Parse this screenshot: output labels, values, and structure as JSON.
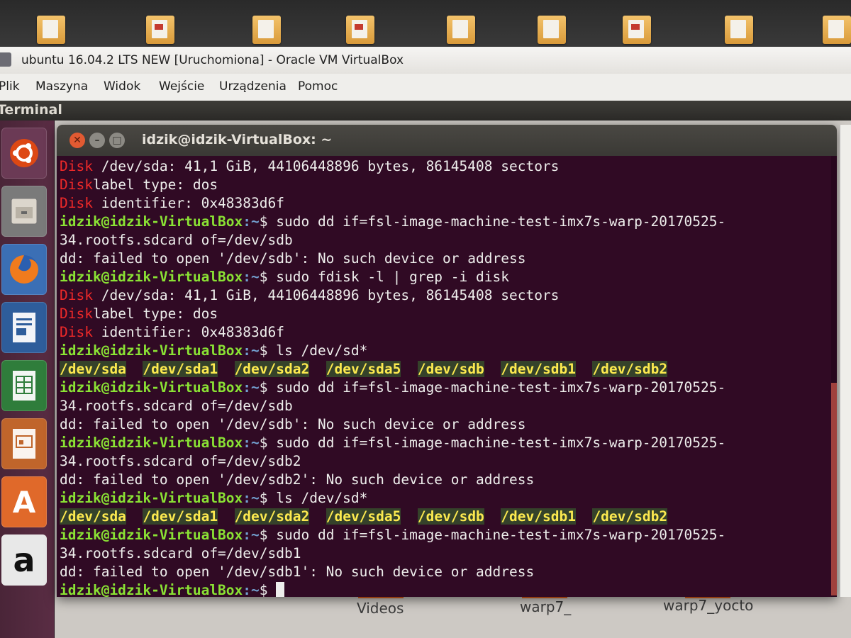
{
  "vbox": {
    "title": "ubuntu 16.04.2 LTS NEW [Uruchomiona] - Oracle VM VirtualBox",
    "menu": [
      "Plik",
      "Maszyna",
      "Widok",
      "Wejście",
      "Urządzenia",
      "Pomoc"
    ]
  },
  "guest": {
    "app_title": "Terminal",
    "launcher": [
      "ubuntu-dash-icon",
      "files-icon",
      "firefox-icon",
      "writer-icon",
      "calc-icon",
      "impress-icon",
      "software-center-icon",
      "amazon-icon"
    ],
    "desktop_labels": [
      "Videos",
      "warp7_",
      "warp7_yocto"
    ]
  },
  "terminal": {
    "title": "idzik@idzik-VirtualBox: ~",
    "prompt_user": "idzik@idzik-VirtualBox",
    "prompt_path": ":~",
    "prompt_sym": "$ ",
    "lines": [
      {
        "k": "disk",
        "red": "Disk",
        "rest": " /dev/sda: 41,1 GiB, 44106448896 bytes, 86145408 sectors"
      },
      {
        "k": "disk",
        "red": "Disk",
        "rest": "label type: dos"
      },
      {
        "k": "disk",
        "red": "Disk",
        "rest": " identifier: 0x48383d6f"
      },
      {
        "k": "cmd",
        "cmd": "sudo dd if=fsl-image-machine-test-imx7s-warp-20170525-"
      },
      {
        "k": "text",
        "text": "34.rootfs.sdcard of=/dev/sdb"
      },
      {
        "k": "text",
        "text": "dd: failed to open '/dev/sdb': No such device or address"
      },
      {
        "k": "cmd",
        "cmd": "sudo fdisk -l | grep -i disk"
      },
      {
        "k": "disk",
        "red": "Disk",
        "rest": " /dev/sda: 41,1 GiB, 44106448896 bytes, 86145408 sectors"
      },
      {
        "k": "disk",
        "red": "Disk",
        "rest": "label type: dos"
      },
      {
        "k": "disk",
        "red": "Disk",
        "rest": " identifier: 0x48383d6f"
      },
      {
        "k": "cmd",
        "cmd": "ls /dev/sd*"
      },
      {
        "k": "devs",
        "devs": [
          "/dev/sda",
          "/dev/sda1",
          "/dev/sda2",
          "/dev/sda5",
          "/dev/sdb",
          "/dev/sdb1",
          "/dev/sdb2"
        ]
      },
      {
        "k": "cmd",
        "cmd": "sudo dd if=fsl-image-machine-test-imx7s-warp-20170525-"
      },
      {
        "k": "text",
        "text": "34.rootfs.sdcard of=/dev/sdb"
      },
      {
        "k": "text",
        "text": "dd: failed to open '/dev/sdb': No such device or address"
      },
      {
        "k": "cmd",
        "cmd": "sudo dd if=fsl-image-machine-test-imx7s-warp-20170525-"
      },
      {
        "k": "text",
        "text": "34.rootfs.sdcard of=/dev/sdb2"
      },
      {
        "k": "text",
        "text": "dd: failed to open '/dev/sdb2': No such device or address"
      },
      {
        "k": "cmd",
        "cmd": "ls /dev/sd*"
      },
      {
        "k": "devs",
        "devs": [
          "/dev/sda",
          "/dev/sda1",
          "/dev/sda2",
          "/dev/sda5",
          "/dev/sdb",
          "/dev/sdb1",
          "/dev/sdb2"
        ]
      },
      {
        "k": "cmd",
        "cmd": "sudo dd if=fsl-image-machine-test-imx7s-warp-20170525-"
      },
      {
        "k": "text",
        "text": "34.rootfs.sdcard of=/dev/sdb1"
      },
      {
        "k": "text",
        "text": "dd: failed to open '/dev/sdb1': No such device or address"
      },
      {
        "k": "cmd",
        "cmd": ""
      }
    ]
  },
  "colors": {
    "terminal_bg": "#300a24",
    "prompt": "#8ae234",
    "path": "#729fcf",
    "error_word": "#ef2929",
    "device": "#fce94f"
  }
}
